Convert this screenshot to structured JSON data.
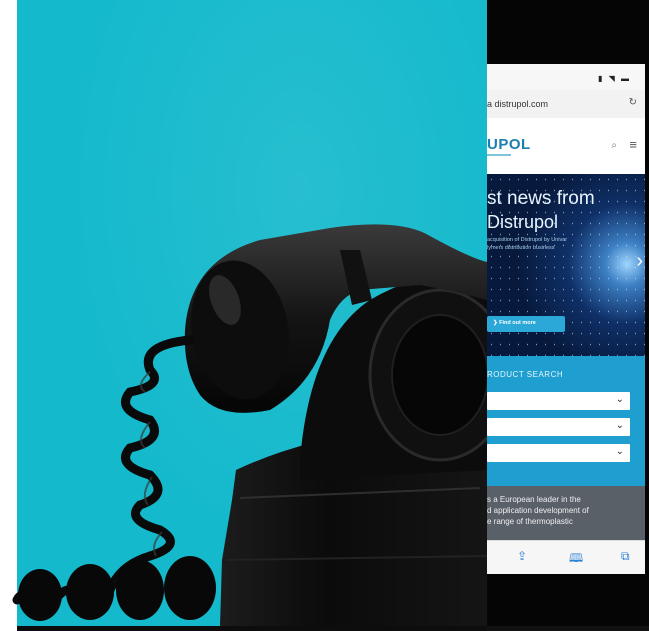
{
  "colors": {
    "background": "#14b9cc",
    "phone_body": "#050505",
    "site_blue": "#1e9fd0",
    "logo_blue": "#1a7fb0"
  },
  "phone": {
    "status_icons": "▮ ◥ ▬",
    "url": "a distrupol.com",
    "reload_icon": "reload-icon",
    "logo": "UPOL",
    "hero": {
      "title_line1": "st news from",
      "title_line2": "Distrupol",
      "text_line1": "acquisition of Distrupol by Univar",
      "text_line2": "lymers distribution business",
      "button": "Find out more"
    },
    "product_search": {
      "label": "RODUCT SEARCH"
    },
    "about": {
      "line1": "s a European leader in the",
      "line2": "d application development of",
      "line3": "e range of thermoplastic"
    }
  }
}
